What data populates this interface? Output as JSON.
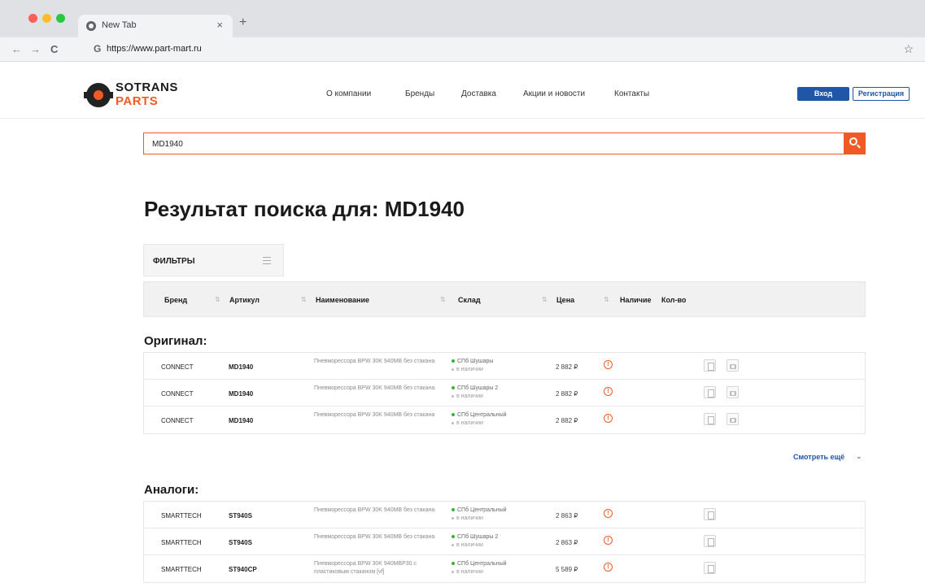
{
  "browser": {
    "tab_title": "New Tab",
    "tab_close": "×",
    "new_tab": "+",
    "back": "←",
    "forward": "→",
    "reload": "C",
    "url_icon": "G",
    "url": "https://www.part-mart.ru",
    "star": "☆"
  },
  "site": {
    "logo_line1": "SOTRANS",
    "logo_line2": "PARTS",
    "nav": [
      "О компании",
      "Бренды",
      "Доставка",
      "Акции и новости",
      "Контакты"
    ],
    "login": "Вход",
    "register": "Регистрация",
    "brand_color": "#f15a24",
    "accent_color": "#1f56a8"
  },
  "search": {
    "value": "MD1940"
  },
  "results": {
    "title": "Результат поиска для: MD1940",
    "filters_label": "ФИЛЬТРЫ",
    "columns": [
      "Бренд",
      "Артикул",
      "Наименование",
      "Склад",
      "Цена",
      "Наличие",
      "Кол-во"
    ],
    "original_title": "Оригинал:",
    "original_rows": [
      {
        "brand": "CONNECT",
        "article": "MD1940",
        "name": "Пневморессора BPW 30K 940MB без стакана",
        "warehouse": "СПб Шушары",
        "availability": "в наличии",
        "price": "2 882 ₽",
        "info": "!"
      },
      {
        "brand": "CONNECT",
        "article": "MD1940",
        "name": "Пневморессора BPW 30K 940MB без стакана",
        "warehouse": "СПб Шушары 2",
        "availability": "в наличии",
        "price": "2 882 ₽",
        "info": "!"
      },
      {
        "brand": "CONNECT",
        "article": "MD1940",
        "name": "Пневморессора BPW 30K 940MB без стакана",
        "warehouse": "СПб Центральный",
        "availability": "в наличии",
        "price": "2 882 ₽",
        "info": "!"
      }
    ],
    "show_more": "Смотреть ещё",
    "show_more_chevron": "⌄",
    "analogs_title": "Аналоги:",
    "analog_rows": [
      {
        "brand": "SMARTTECH",
        "article": "ST940S",
        "name": "Пневморессора BPW 30K 940MB без стакана",
        "warehouse": "СПб Центральный",
        "availability": "в наличии",
        "price": "2 863 ₽",
        "info": "!"
      },
      {
        "brand": "SMARTTECH",
        "article": "ST940S",
        "name": "Пневморессора BPW 30K 940MB без стакана",
        "warehouse": "СПб Шушары 2",
        "availability": "в наличии",
        "price": "2 863 ₽",
        "info": "!"
      },
      {
        "brand": "SMARTTECH",
        "article": "ST940CP",
        "name": "Пневморессора BPW 30K 940MBP30 с пластиковым стаканом [vf]",
        "warehouse": "СПб Центральный",
        "availability": "в наличии",
        "price": "5 589 ₽",
        "info": "!"
      }
    ]
  }
}
